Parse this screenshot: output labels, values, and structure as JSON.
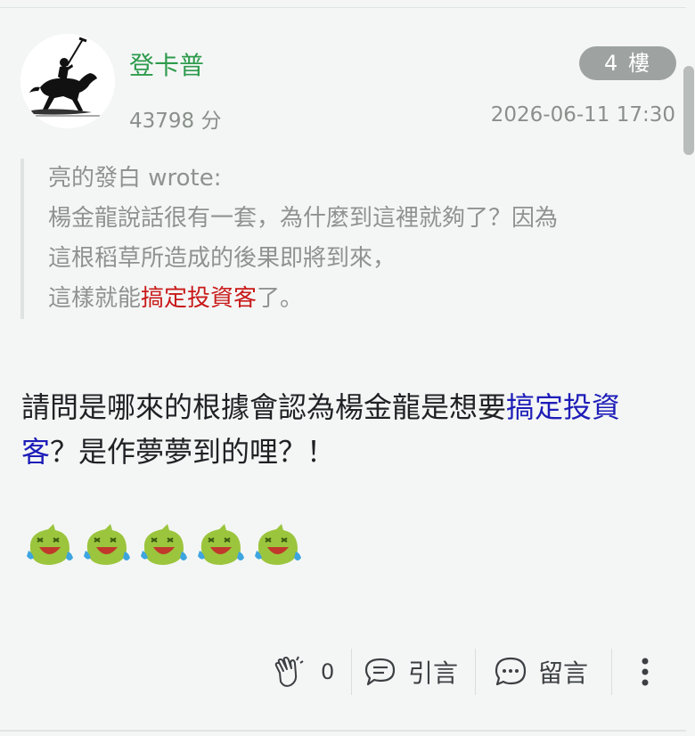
{
  "post": {
    "author": "登卡普",
    "points": "43798 分",
    "floor": "4 樓",
    "timestamp": "2026-06-11 17:30"
  },
  "quote": {
    "line1": "亮的發白 wrote:",
    "line2": "楊金龍說話很有一套，為什麼到這裡就夠了？因為",
    "line3": "這根稻草所造成的後果即將到來，",
    "line4_prefix": "這樣就能",
    "line4_highlight": "搞定投資客",
    "line4_suffix": "了。"
  },
  "body": {
    "line1_text": "請問是哪來的根據會認為楊金龍是想要",
    "line1_link": "搞定投資",
    "line2_link": "客",
    "line2_text": "？是作夢夢到的哩？！"
  },
  "emojis": [
    "crying-laughing-emoji",
    "crying-laughing-emoji",
    "crying-laughing-emoji",
    "crying-laughing-emoji",
    "crying-laughing-emoji"
  ],
  "actions": {
    "like_count": "0",
    "quote_label": "引言",
    "comment_label": "留言"
  },
  "icons": [
    "clap-icon",
    "quote-bubble-icon",
    "comment-bubble-icon",
    "more-vertical-icon",
    "polo-horse-avatar"
  ],
  "colors": {
    "author": "#2e9b4d",
    "highlight": "#c91a1a",
    "link": "#1d1db8",
    "badge": "#9ea3a1"
  }
}
